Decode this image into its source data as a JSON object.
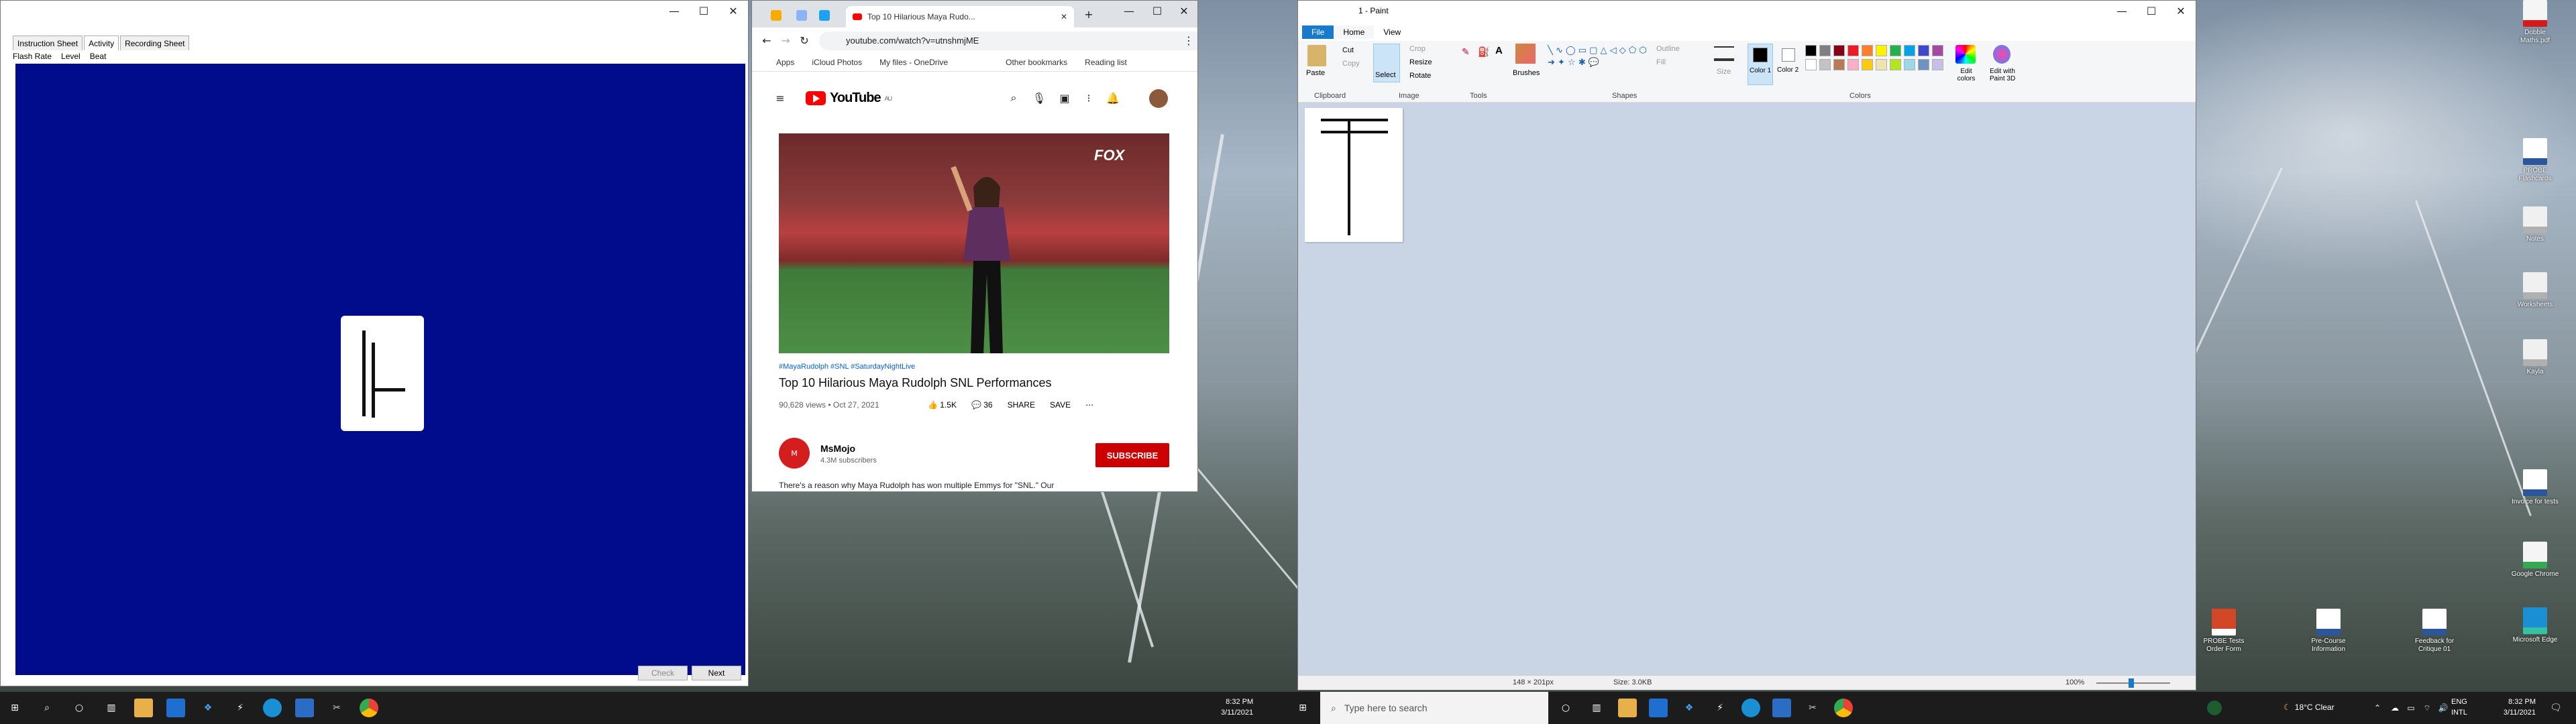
{
  "activity_window": {
    "tabs": [
      "Instruction Sheet",
      "Activity",
      "Recording Sheet"
    ],
    "active_tab": "Activity",
    "menu": [
      "Flash Rate",
      "Level",
      "Beat"
    ],
    "check_label": "Check",
    "next_label": "Next",
    "canvas_color": "#000c8c"
  },
  "chrome": {
    "tab_title": "Top 10 Hilarious Maya Rudo...",
    "url": "youtube.com/watch?v=utnshmjME",
    "bookmarks": [
      "Apps",
      "iCloud Photos",
      "My files - OneDrive",
      "Other bookmarks",
      "Reading list"
    ],
    "yt_logo_text": "YouTube",
    "yt_region": "AU",
    "video_tags": "#MayaRudolph #SNL #SaturdayNightLive",
    "video_title": "Top 10 Hilarious Maya Rudolph SNL Performances",
    "video_stats": "90,628 views • Oct 27, 2021",
    "likes": "1.5K",
    "comments": "36",
    "share_label": "SHARE",
    "save_label": "SAVE",
    "channel_name": "MsMojo",
    "channel_subs": "4.3M subscribers",
    "subscribe_label": "SUBSCRIBE",
    "description": "There's a reason why Maya Rudolph has won multiple Emmys for \"SNL.\" Our",
    "fox_badge": "FOX",
    "accent": "#ff0000"
  },
  "paint": {
    "title": "1 - Paint",
    "tabs": [
      "File",
      "Home",
      "View"
    ],
    "groups": [
      "Clipboard",
      "Image",
      "Tools",
      "Shapes",
      "Colors"
    ],
    "paste_label": "Paste",
    "cut_label": "Cut",
    "copy_label": "Copy",
    "select_label": "Select",
    "crop_label": "Crop",
    "resize_label": "Resize",
    "rotate_label": "Rotate",
    "brushes_label": "Brushes",
    "outline_label": "Outline",
    "fill_label": "Fill",
    "size_label": "Size",
    "color1_label": "Color 1",
    "color2_label": "Color 2",
    "edit_colors_label": "Edit colors",
    "paint3d_label": "Edit with Paint 3D",
    "canvas_dims": "148 × 201px",
    "file_size": "Size: 3.0KB",
    "zoom": "100%",
    "palette": [
      "#000000",
      "#7f7f7f",
      "#880015",
      "#ed1c24",
      "#ff7f27",
      "#fff200",
      "#22b14c",
      "#00a2e8",
      "#3f48cc",
      "#a349a4",
      "#ffffff",
      "#c3c3c3",
      "#b97a57",
      "#ffaec9",
      "#ffc90e",
      "#efe4b0",
      "#b5e61d",
      "#99d9ea",
      "#7092be",
      "#c8bfe7"
    ]
  },
  "desktop_icons": [
    {
      "label": "Dobble Maths.pdf",
      "kind": "pdf"
    },
    {
      "label": "PROBE Flashcards",
      "kind": "word"
    },
    {
      "label": "Notes",
      "kind": "file"
    },
    {
      "label": "Worksheets",
      "kind": "file"
    },
    {
      "label": "Kayla",
      "kind": "file"
    },
    {
      "label": "Invoice for tests",
      "kind": "word"
    },
    {
      "label": "Google Chrome",
      "kind": "chrome"
    },
    {
      "label": "Microsoft Edge",
      "kind": "edge"
    },
    {
      "label": "PROBE Tests Order Form",
      "kind": "ppt"
    },
    {
      "label": "Pre-Course Information",
      "kind": "word"
    },
    {
      "label": "Feedback for Critique 01",
      "kind": "word"
    }
  ],
  "taskbar": {
    "search_placeholder": "Type here to search",
    "time": "8:32 PM",
    "date": "3/11/2021",
    "weather": "18°C  Clear",
    "lang_top": "ENG",
    "lang_bottom": "INTL"
  }
}
